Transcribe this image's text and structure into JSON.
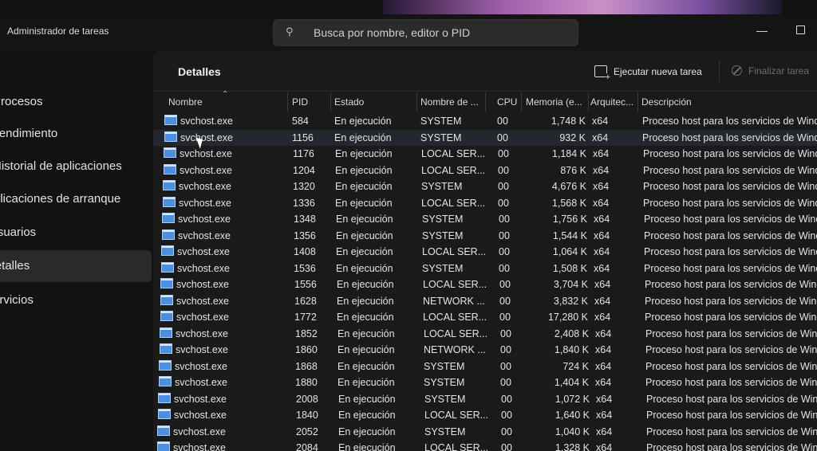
{
  "window": {
    "title": "Administrador de tareas",
    "minimize_glyph": "—"
  },
  "search": {
    "placeholder": "Busca por nombre, editor o PID",
    "icon": "search-icon"
  },
  "sidebar": {
    "items": [
      {
        "label": "Procesos",
        "active": false
      },
      {
        "label": "Rendimiento",
        "active": false
      },
      {
        "label": "Historial de aplicaciones",
        "active": false
      },
      {
        "label": "Aplicaciones de arranque",
        "active": false
      },
      {
        "label": "Usuarios",
        "active": false
      },
      {
        "label": "Detalles",
        "active": true
      },
      {
        "label": "Servicios",
        "active": false
      }
    ]
  },
  "panel": {
    "title": "Detalles",
    "run_task_label": "Ejecutar nueva tarea",
    "end_task_label": "Finalizar tarea"
  },
  "table": {
    "columns": [
      "Nombre",
      "PID",
      "Estado",
      "Nombre de ...",
      "CPU",
      "Memoria (e...",
      "Arquitec...",
      "Descripción"
    ],
    "sorted_column": "Nombre",
    "rows": [
      {
        "name": "svchost.exe",
        "pid": "584",
        "status": "En ejecución",
        "user": "SYSTEM",
        "cpu": "00",
        "memory": "1,748 K",
        "arch": "x64",
        "desc": "Proceso host para los servicios de Windows"
      },
      {
        "name": "svchost.exe",
        "pid": "1156",
        "status": "En ejecución",
        "user": "SYSTEM",
        "cpu": "00",
        "memory": "932 K",
        "arch": "x64",
        "desc": "Proceso host para los servicios de Windows"
      },
      {
        "name": "svchost.exe",
        "pid": "1176",
        "status": "En ejecución",
        "user": "LOCAL SER...",
        "cpu": "00",
        "memory": "1,184 K",
        "arch": "x64",
        "desc": "Proceso host para los servicios de Windows"
      },
      {
        "name": "svchost.exe",
        "pid": "1204",
        "status": "En ejecución",
        "user": "LOCAL SER...",
        "cpu": "00",
        "memory": "876 K",
        "arch": "x64",
        "desc": "Proceso host para los servicios de Windows"
      },
      {
        "name": "svchost.exe",
        "pid": "1320",
        "status": "En ejecución",
        "user": "SYSTEM",
        "cpu": "00",
        "memory": "4,676 K",
        "arch": "x64",
        "desc": "Proceso host para los servicios de Windows"
      },
      {
        "name": "svchost.exe",
        "pid": "1336",
        "status": "En ejecución",
        "user": "LOCAL SER...",
        "cpu": "00",
        "memory": "1,568 K",
        "arch": "x64",
        "desc": "Proceso host para los servicios de Windows"
      },
      {
        "name": "svchost.exe",
        "pid": "1348",
        "status": "En ejecución",
        "user": "SYSTEM",
        "cpu": "00",
        "memory": "1,756 K",
        "arch": "x64",
        "desc": "Proceso host para los servicios de Windows"
      },
      {
        "name": "svchost.exe",
        "pid": "1356",
        "status": "En ejecución",
        "user": "SYSTEM",
        "cpu": "00",
        "memory": "1,544 K",
        "arch": "x64",
        "desc": "Proceso host para los servicios de Windows"
      },
      {
        "name": "svchost.exe",
        "pid": "1408",
        "status": "En ejecución",
        "user": "LOCAL SER...",
        "cpu": "00",
        "memory": "1,064 K",
        "arch": "x64",
        "desc": "Proceso host para los servicios de Windows"
      },
      {
        "name": "svchost.exe",
        "pid": "1536",
        "status": "En ejecución",
        "user": "SYSTEM",
        "cpu": "00",
        "memory": "1,508 K",
        "arch": "x64",
        "desc": "Proceso host para los servicios de Windows"
      },
      {
        "name": "svchost.exe",
        "pid": "1556",
        "status": "En ejecución",
        "user": "LOCAL SER...",
        "cpu": "00",
        "memory": "3,704 K",
        "arch": "x64",
        "desc": "Proceso host para los servicios de Windows"
      },
      {
        "name": "svchost.exe",
        "pid": "1628",
        "status": "En ejecución",
        "user": "NETWORK ...",
        "cpu": "00",
        "memory": "3,832 K",
        "arch": "x64",
        "desc": "Proceso host para los servicios de Windows"
      },
      {
        "name": "svchost.exe",
        "pid": "1772",
        "status": "En ejecución",
        "user": "LOCAL SER...",
        "cpu": "00",
        "memory": "17,280 K",
        "arch": "x64",
        "desc": "Proceso host para los servicios de Windows"
      },
      {
        "name": "svchost.exe",
        "pid": "1852",
        "status": "En ejecución",
        "user": "LOCAL SER...",
        "cpu": "00",
        "memory": "2,408 K",
        "arch": "x64",
        "desc": "Proceso host para los servicios de Windows"
      },
      {
        "name": "svchost.exe",
        "pid": "1860",
        "status": "En ejecución",
        "user": "NETWORK ...",
        "cpu": "00",
        "memory": "1,840 K",
        "arch": "x64",
        "desc": "Proceso host para los servicios de Windows"
      },
      {
        "name": "svchost.exe",
        "pid": "1868",
        "status": "En ejecución",
        "user": "SYSTEM",
        "cpu": "00",
        "memory": "724 K",
        "arch": "x64",
        "desc": "Proceso host para los servicios de Windows"
      },
      {
        "name": "svchost.exe",
        "pid": "1880",
        "status": "En ejecución",
        "user": "SYSTEM",
        "cpu": "00",
        "memory": "1,404 K",
        "arch": "x64",
        "desc": "Proceso host para los servicios de Windows"
      },
      {
        "name": "svchost.exe",
        "pid": "2008",
        "status": "En ejecución",
        "user": "SYSTEM",
        "cpu": "00",
        "memory": "1,072 K",
        "arch": "x64",
        "desc": "Proceso host para los servicios de Windows"
      },
      {
        "name": "svchost.exe",
        "pid": "1840",
        "status": "En ejecución",
        "user": "LOCAL SER...",
        "cpu": "00",
        "memory": "1,640 K",
        "arch": "x64",
        "desc": "Proceso host para los servicios de Windows"
      },
      {
        "name": "svchost.exe",
        "pid": "2052",
        "status": "En ejecución",
        "user": "SYSTEM",
        "cpu": "00",
        "memory": "1,040 K",
        "arch": "x64",
        "desc": "Proceso host para los servicios de Windows"
      },
      {
        "name": "svchost.exe",
        "pid": "2084",
        "status": "En ejecución",
        "user": "LOCAL SER...",
        "cpu": "00",
        "memory": "1,328 K",
        "arch": "x64",
        "desc": "Proceso host para los servicios de Windows"
      }
    ]
  }
}
